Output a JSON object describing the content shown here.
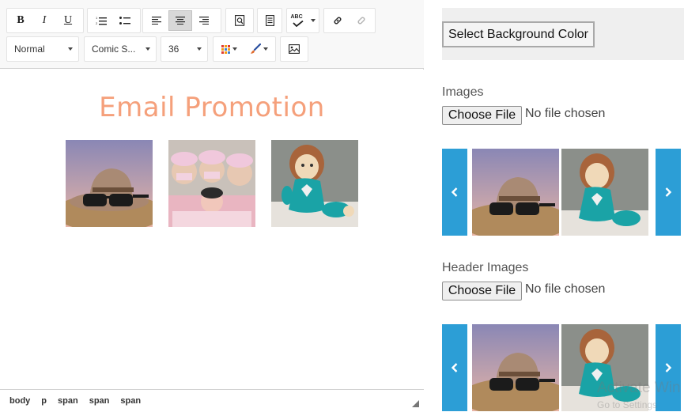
{
  "editor": {
    "toolbar": {
      "bold_label": "B",
      "italic_label": "I",
      "underline_label": "U",
      "spellcheck_label": "ABC",
      "format_select": "Normal",
      "font_select": "Comic S...",
      "size_select": "36"
    },
    "content": {
      "title": "Email Promotion",
      "images": [
        "hat-sunglasses-photo",
        "nurses-baby-photo",
        "knitted-doll-photo"
      ],
      "title_color": "#f5a07b"
    },
    "status_path": [
      "body",
      "p",
      "span",
      "span",
      "span"
    ]
  },
  "panel": {
    "background_button": "Select Background Color",
    "images_label": "Images",
    "images_file_button": "Choose File",
    "images_file_status": "No file chosen",
    "images_carousel": [
      "hat-sunglasses-photo",
      "knitted-doll-photo"
    ],
    "header_images_label": "Header Images",
    "header_file_button": "Choose File",
    "header_file_status": "No file chosen",
    "header_carousel": [
      "hat-sunglasses-photo",
      "knitted-doll-photo"
    ],
    "accent_color": "#2c9ed6",
    "watermark_line1": "Activate Win",
    "watermark_line2": "Go to Settings"
  }
}
